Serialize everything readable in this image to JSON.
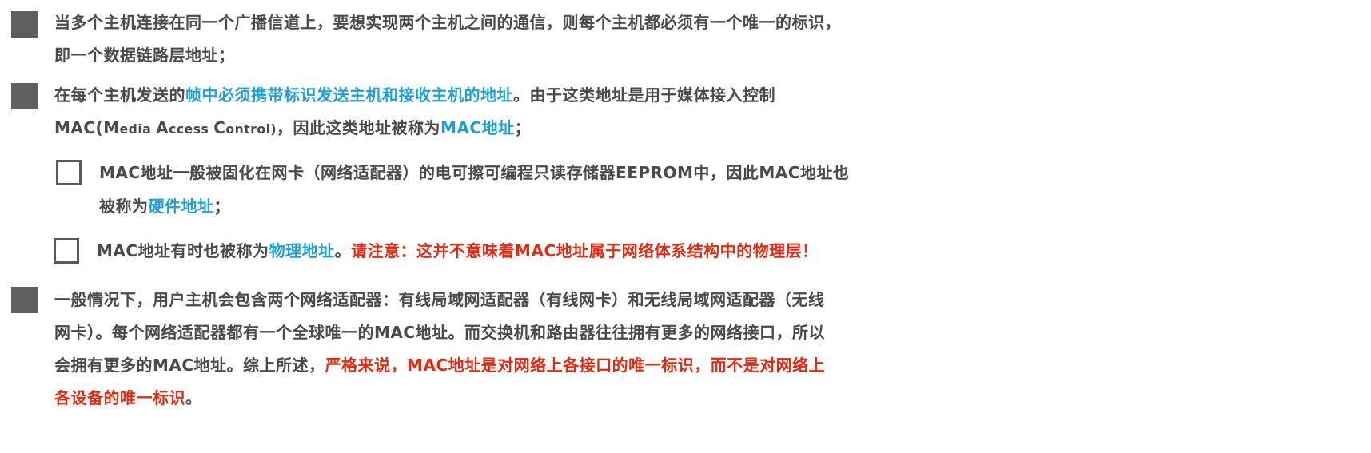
{
  "paragraph1": {
    "line1": "当多个主机连接在同一个广播信道上，要想实现两个主机之间的通信，则每个主机都必须有一个唯一的标识，",
    "line2": "即一个数据链路层地址；"
  },
  "paragraph2": {
    "line1_prefix": "在每个主机发送的",
    "line1_highlight": "帧中必须携带标识发送主机和接收主机的地址",
    "line1_suffix": "。由于这类地址是用于媒体接入控制",
    "line2_mac": "MAC(",
    "line2_m": "M",
    "line2_edia": "edia ",
    "line2_a": "A",
    "line2_ccess": "ccess ",
    "line2_c": "C",
    "line2_ontrol": "ontrol)",
    "line2_mid": "，因此这类地址被称为",
    "line2_highlight": "MAC地址",
    "line2_end": "；"
  },
  "sub1": {
    "line1": "MAC地址一般被固化在网卡（网络适配器）的电可擦可编程只读存储器EEPROM中，因此MAC地址也",
    "line2_prefix": "被称为",
    "line2_highlight": "硬件地址",
    "line2_end": "；"
  },
  "sub2": {
    "prefix": "MAC地址有时也被称为",
    "highlight": "物理地址",
    "mid": "。",
    "warning": "请注意：这并不意味着MAC地址属于网络体系结构中的物理层！"
  },
  "paragraph3": {
    "line1": "一般情况下，用户主机会包含两个网络适配器：有线局域网适配器（有线网卡）和无线局域网适配器（无线",
    "line2": "网卡）。每个网络适配器都有一个全球唯一的MAC地址。而交换机和路由器往往拥有更多的网络接口，所以",
    "line3_prefix": "会拥有更多的MAC地址。综上所述，",
    "line3_highlight": "严格来说，MAC地址是对网络上各接口的唯一标识，而不是对网络上",
    "line4_highlight": "各设备的唯一标识",
    "line4_end": "。"
  },
  "colors": {
    "text": "#4a4a4a",
    "blue_highlight": "#1f9fd6",
    "red_highlight": "#e32a12",
    "bullet": "#5f5f5f"
  }
}
